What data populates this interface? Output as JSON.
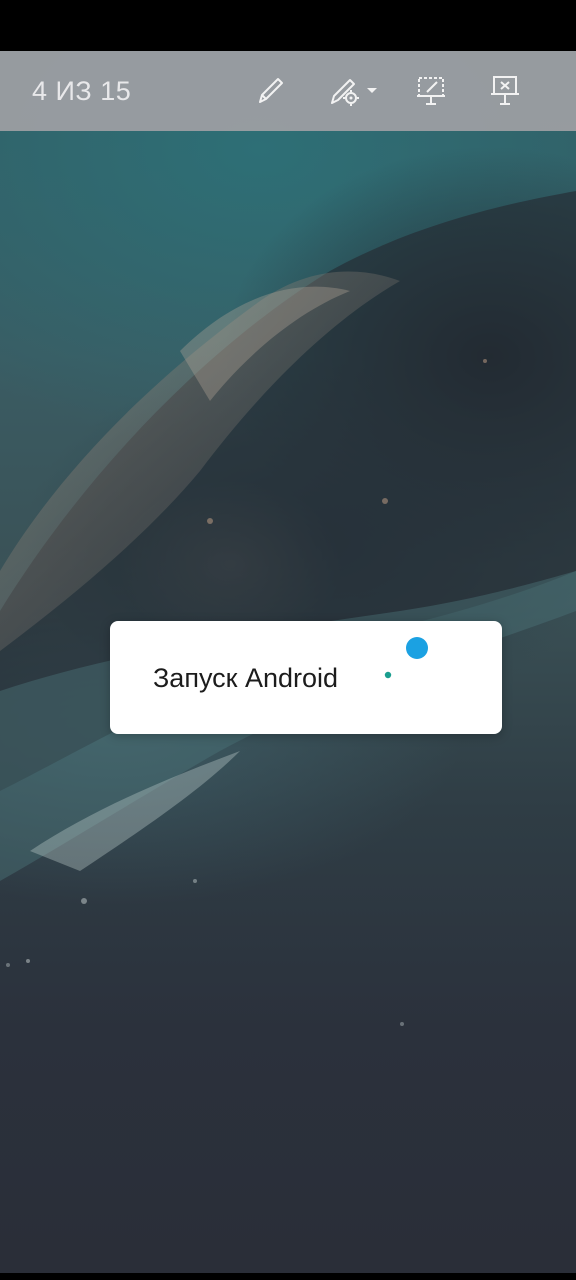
{
  "toolbar": {
    "slide_counter": "4 ИЗ 15",
    "tools": [
      {
        "icon": "pen-icon"
      },
      {
        "icon": "highlighter-settings-icon"
      },
      {
        "icon": "screen-annotate-icon"
      },
      {
        "icon": "end-slideshow-icon"
      }
    ]
  },
  "dialog": {
    "message": "Запуск Android",
    "spinner_colors": [
      "#1ba1e2",
      "#1a9e8f"
    ]
  },
  "colors": {
    "toolbar_bg": "#a0a0a4",
    "toolbar_text": "#e8e8ea",
    "dialog_bg": "#ffffff"
  }
}
